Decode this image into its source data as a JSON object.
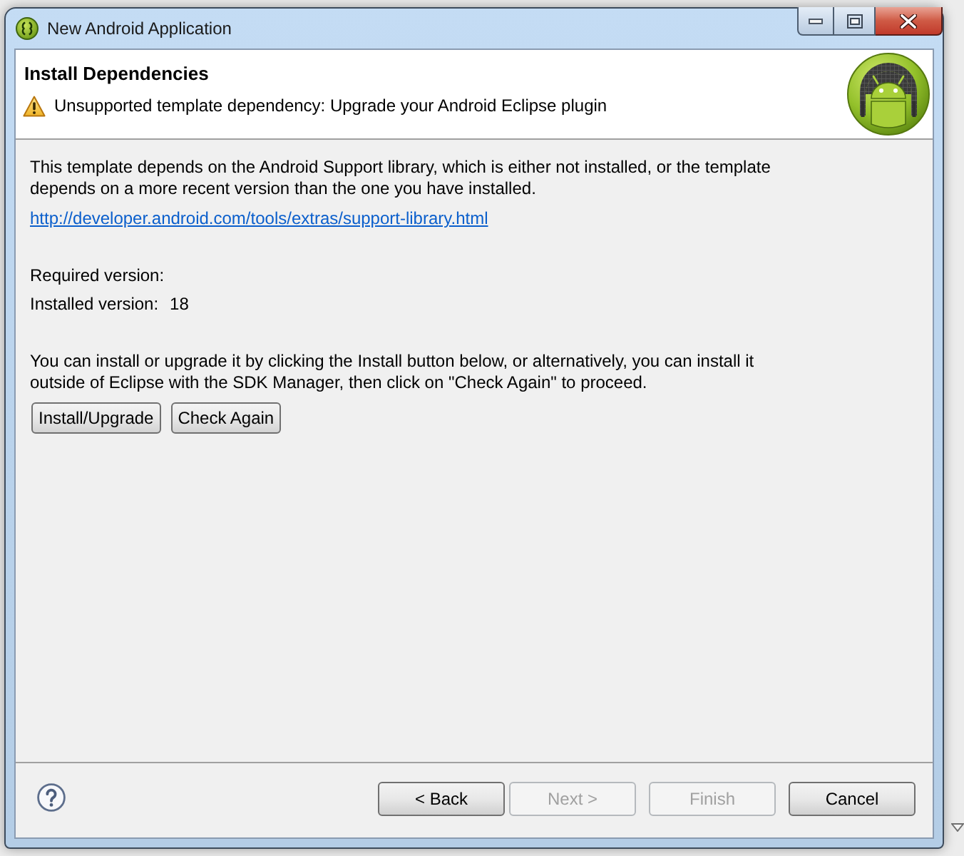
{
  "window": {
    "title": "New Android Application"
  },
  "header": {
    "title": "Install Dependencies",
    "message": {
      "kind": "warning",
      "text": "Unsupported template dependency: Upgrade your Android Eclipse plugin"
    }
  },
  "body": {
    "description": "This template depends on the Android Support library, which is either not installed, or the template depends on a more recent version than the one you have installed.",
    "link": "http://developer.android.com/tools/extras/support-library.html",
    "versions": [
      {
        "label": "Required version:"
      },
      {
        "label": "Installed version:",
        "value": "18"
      }
    ],
    "instructions": "You can install or upgrade it by clicking the Install button below, or alternatively, you can install it outside of Eclipse with the SDK Manager, then click on \"Check Again\" to proceed.",
    "actions": [
      {
        "label": "Install/Upgrade"
      },
      {
        "label": "Check Again"
      }
    ]
  },
  "footer": {
    "buttons": [
      {
        "label": "< Back",
        "disabled": false
      },
      {
        "label": "Next >",
        "disabled": true
      },
      {
        "label": "Finish",
        "disabled": true
      },
      {
        "label": "Cancel",
        "disabled": false
      }
    ]
  }
}
